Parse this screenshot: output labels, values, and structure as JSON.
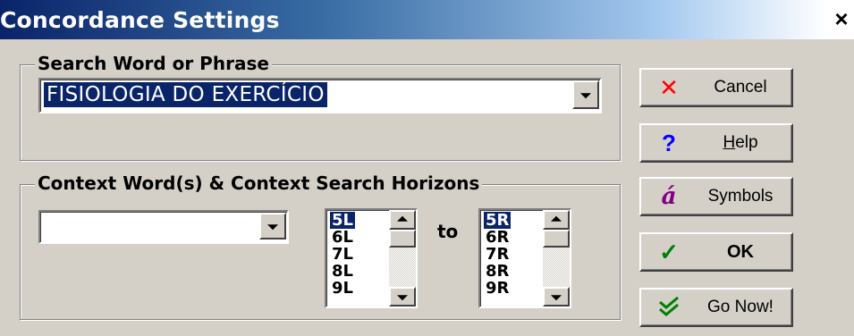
{
  "window": {
    "title": "Concordance Settings",
    "close_glyph": "×"
  },
  "search_group": {
    "legend": "Search Word or Phrase",
    "value": "FISIOLOGIA DO EXERCÍCIO"
  },
  "context_group": {
    "legend": "Context Word(s) & Context Search Horizons",
    "context_value": "",
    "to_label": "to",
    "left_horizon": [
      "5L",
      "6L",
      "7L",
      "8L",
      "9L"
    ],
    "left_selected": "5L",
    "right_horizon": [
      "5R",
      "6R",
      "7R",
      "8R",
      "9R"
    ],
    "right_selected": "5R"
  },
  "buttons": {
    "cancel": {
      "label": "Cancel",
      "icon": "x-icon",
      "glyph": "✕",
      "color": "#ff0000"
    },
    "help": {
      "label_mnemonic": "H",
      "label_rest": "elp",
      "icon": "question-icon",
      "glyph": "?",
      "color": "#0000ff"
    },
    "symbols": {
      "label": "Symbols",
      "icon": "accented-a-icon",
      "glyph": "á",
      "color": "#800080"
    },
    "ok": {
      "label": "OK",
      "icon": "checkmark-icon",
      "glyph": "✓",
      "color": "#008000"
    },
    "go_now": {
      "label": "Go Now!",
      "icon": "double-check-icon",
      "glyph": "»",
      "color": "#008000"
    }
  },
  "colors": {
    "face": "#d4d0c8",
    "selection": "#0a246a",
    "title_start": "#0a246a"
  }
}
